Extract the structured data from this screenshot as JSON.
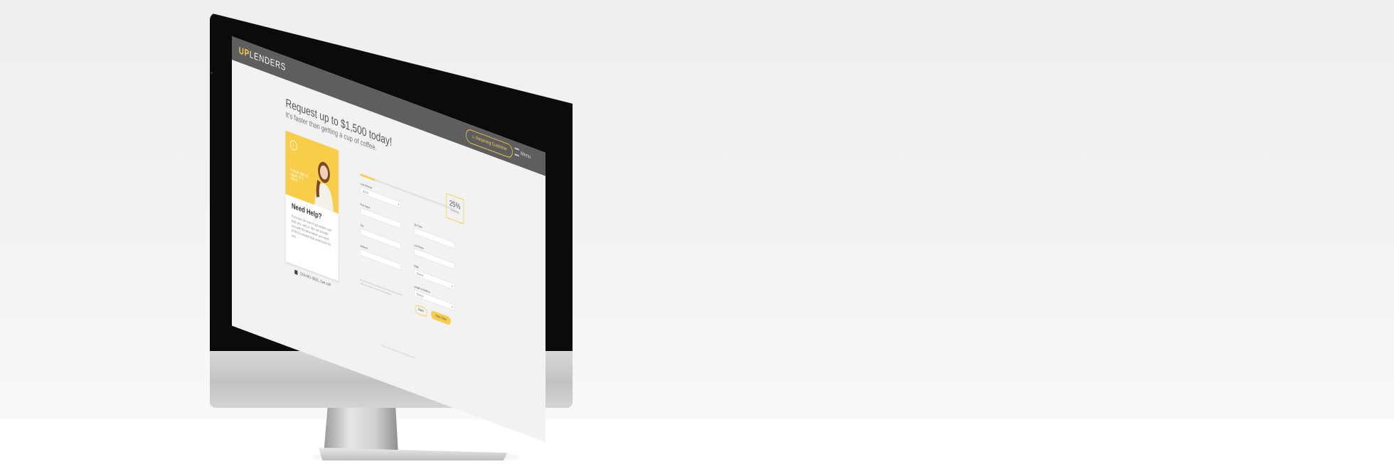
{
  "header": {
    "logo_up": "UP",
    "logo_rest": "LENDERS",
    "login_button": "Returning Customer",
    "menu_label": "Menu"
  },
  "hero": {
    "title": "Request up to $1,500 today!",
    "subtitle": "It's faster than getting a cup of coffee."
  },
  "help_card": {
    "banner_text": "Follow tips to apply in 5 mins!",
    "title": "Need Help?",
    "body": "If you are not sure if UpLenders can help you, call us. We can provide you with the information you need to find a solution that works best for you.",
    "phone": "216-961-3581, Get call"
  },
  "progress": {
    "percent_label": "25%",
    "percent_sub": "Complete",
    "fraction": 0.15
  },
  "form": {
    "left": [
      {
        "label": "Loan Amount",
        "value": "$150",
        "select": true
      },
      {
        "label": "First Name",
        "value": ""
      },
      {
        "label": "City",
        "value": ""
      },
      {
        "label": "Address",
        "value": ""
      }
    ],
    "right": [
      {
        "label": "Zip Code",
        "value": ""
      },
      {
        "label": "Last Name",
        "value": ""
      },
      {
        "label": "State",
        "value": "Select",
        "select": true
      },
      {
        "label": "Length at Address",
        "value": "Select",
        "select": true
      }
    ],
    "legal": "By clicking Next Step you agree to our terms of use and privacy policy and consent to receive communications.",
    "back_button": "Back",
    "next_button": "Next Step"
  },
  "footer": {
    "text": "© 2015 - 2018 UpLenders.com  All Rights Reserved"
  },
  "colors": {
    "accent": "#f7cd4a",
    "topbar": "#5e5e5e"
  }
}
